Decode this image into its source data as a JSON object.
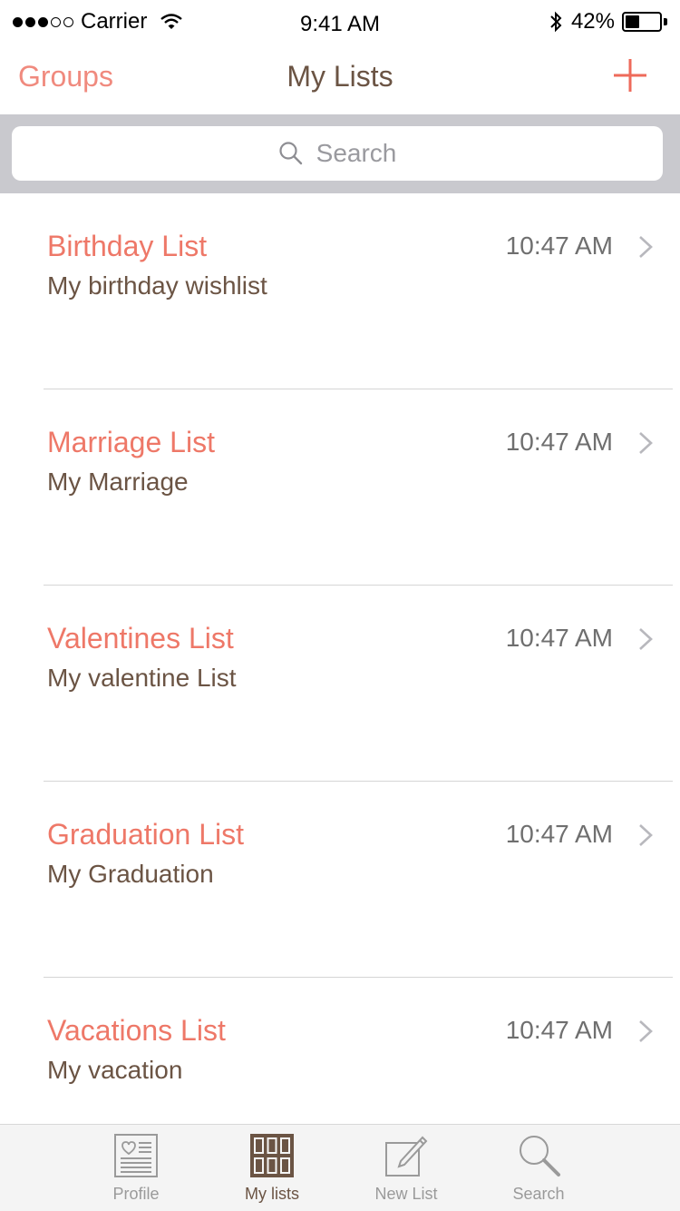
{
  "status_bar": {
    "carrier": "Carrier",
    "time": "9:41 AM",
    "battery_percent": "42%",
    "battery_level": 0.42
  },
  "nav": {
    "left_label": "Groups",
    "title": "My Lists",
    "add_icon": "plus-icon"
  },
  "search": {
    "placeholder": "Search"
  },
  "lists": [
    {
      "title": "Birthday List",
      "subtitle": "My birthday wishlist",
      "time": "10:47 AM"
    },
    {
      "title": "Marriage List",
      "subtitle": "My Marriage",
      "time": "10:47 AM"
    },
    {
      "title": "Valentines List",
      "subtitle": "My valentine List",
      "time": "10:47 AM"
    },
    {
      "title": "Graduation List",
      "subtitle": "My Graduation",
      "time": "10:47 AM"
    },
    {
      "title": "Vacations List",
      "subtitle": "My vacation",
      "time": "10:47 AM"
    }
  ],
  "tabs": [
    {
      "label": "Profile",
      "icon": "profile-icon",
      "active": false
    },
    {
      "label": "My lists",
      "icon": "grid-icon",
      "active": true
    },
    {
      "label": "New List",
      "icon": "edit-icon",
      "active": false
    },
    {
      "label": "Search",
      "icon": "search-icon",
      "active": false
    }
  ],
  "colors": {
    "accent": "#ee7868",
    "brown": "#6b5444",
    "search_bar_bg": "#c9c9ce"
  }
}
